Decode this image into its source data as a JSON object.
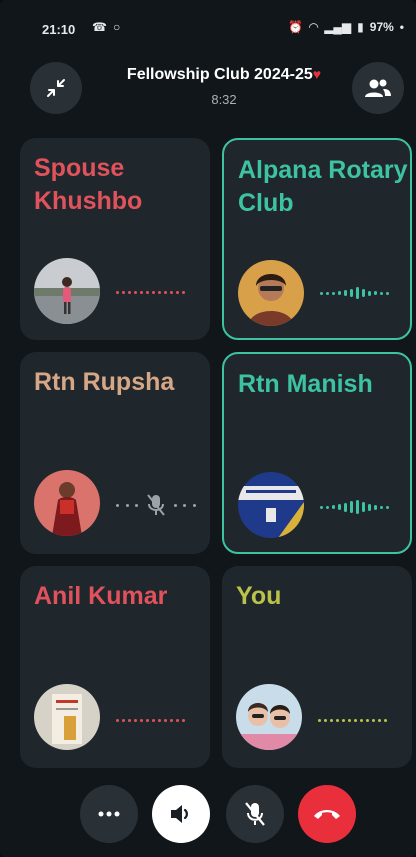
{
  "status_bar": {
    "time": "21:10",
    "battery": "97%"
  },
  "header": {
    "title": "Fellowship Club 2024-25",
    "timer": "8:32",
    "minimize_icon": "minimize-icon",
    "participants_icon": "participants-icon"
  },
  "tiles": [
    {
      "name": "Spouse Khushbo",
      "color": "#e0525c",
      "state": "idle"
    },
    {
      "name": "Alpana Rotary Club",
      "color": "#3ec3a2",
      "state": "speaking"
    },
    {
      "name": "Rtn Rupsha",
      "color": "#d5a786",
      "state": "muted"
    },
    {
      "name": "Rtn Manish",
      "color": "#3ec3a2",
      "state": "speaking"
    },
    {
      "name": "Anil Kumar",
      "color": "#e0525c",
      "state": "idle"
    },
    {
      "name": "You",
      "color": "#b9c34a",
      "state": "idle"
    }
  ],
  "controls": {
    "more": "more-icon",
    "speaker": "speaker-icon",
    "mic": "mic-off-icon",
    "end": "end-call-icon"
  },
  "colors": {
    "background": "#10161a",
    "tile": "#20272c",
    "speaking_border": "#3ec3a2",
    "end_call": "#ea2f3c"
  }
}
